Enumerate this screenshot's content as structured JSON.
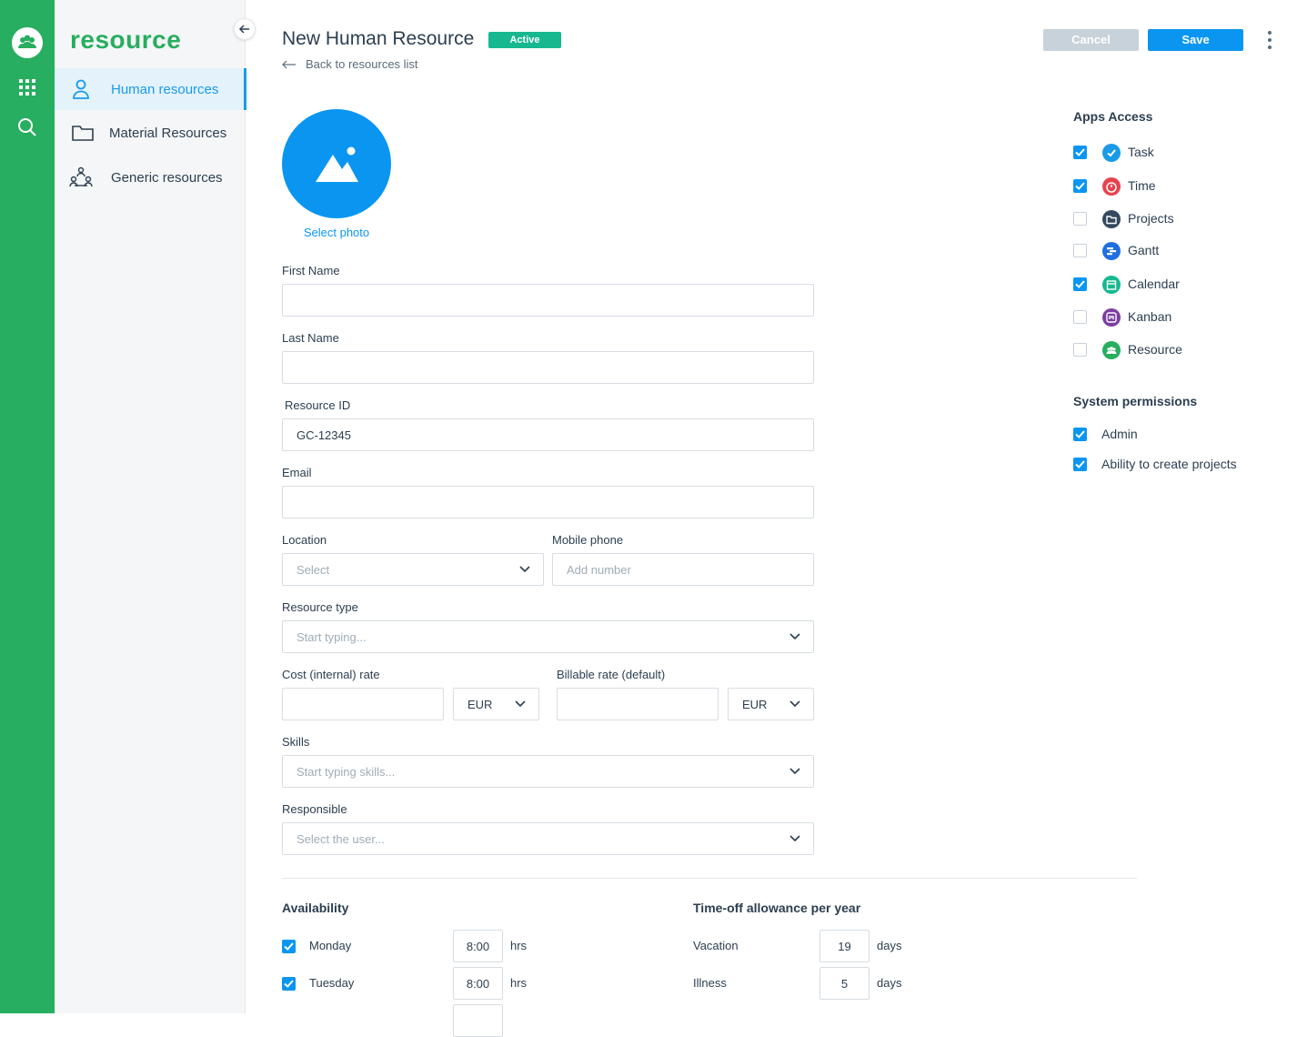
{
  "app": {
    "brand": "resource"
  },
  "sidebar": {
    "items": [
      {
        "label": "Human resources",
        "icon": "person-icon",
        "active": true
      },
      {
        "label": "Material Resources",
        "icon": "folder-icon",
        "active": false
      },
      {
        "label": "Generic resources",
        "icon": "group-icon",
        "active": false
      }
    ]
  },
  "header": {
    "title": "New Human Resource",
    "status": "Active",
    "back_link": "Back to resources list",
    "cancel_label": "Cancel",
    "save_label": "Save"
  },
  "photo": {
    "select_label": "Select photo"
  },
  "form": {
    "first_name": {
      "label": "First Name",
      "value": ""
    },
    "last_name": {
      "label": "Last Name",
      "value": ""
    },
    "resource_id": {
      "label": "Resource ID",
      "value": "GC-12345"
    },
    "email": {
      "label": "Email",
      "value": ""
    },
    "location": {
      "label": "Location",
      "placeholder": "Select"
    },
    "mobile_phone": {
      "label": "Mobile phone",
      "placeholder": "Add number"
    },
    "resource_type": {
      "label": "Resource type",
      "placeholder": "Start typing..."
    },
    "cost_rate": {
      "label": "Cost (internal) rate",
      "value": "",
      "currency": "EUR"
    },
    "billable_rate": {
      "label": "Billable rate (default)",
      "value": "",
      "currency": "EUR"
    },
    "skills": {
      "label": "Skills",
      "placeholder": "Start typing skills..."
    },
    "responsible": {
      "label": "Responsible",
      "placeholder": "Select the user..."
    }
  },
  "apps_access": {
    "title": "Apps Access",
    "apps": [
      {
        "label": "Task",
        "checked": true,
        "color": "#1a9be8"
      },
      {
        "label": "Time",
        "checked": true,
        "color": "#e8424f"
      },
      {
        "label": "Projects",
        "checked": false,
        "color": "#34495e"
      },
      {
        "label": "Gantt",
        "checked": false,
        "color": "#1f6fe0"
      },
      {
        "label": "Calendar",
        "checked": true,
        "color": "#17b890"
      },
      {
        "label": "Kanban",
        "checked": false,
        "color": "#7b3fa0"
      },
      {
        "label": "Resource",
        "checked": false,
        "color": "#27ae60"
      }
    ]
  },
  "system_permissions": {
    "title": "System permissions",
    "items": [
      {
        "label": "Admin",
        "checked": true
      },
      {
        "label": "Ability to create projects",
        "checked": true
      }
    ]
  },
  "availability": {
    "title": "Availability",
    "unit": "hrs",
    "days": [
      {
        "label": "Monday",
        "checked": true,
        "hours": "8:00"
      },
      {
        "label": "Tuesday",
        "checked": true,
        "hours": "8:00"
      }
    ]
  },
  "time_off": {
    "title": "Time-off allowance per year",
    "unit": "days",
    "items": [
      {
        "label": "Vacation",
        "value": "19"
      },
      {
        "label": "Illness",
        "value": "5"
      }
    ]
  },
  "colors": {
    "brand_green": "#27ae60",
    "accent_blue": "#0a96f0",
    "active_badge": "#17b890"
  }
}
